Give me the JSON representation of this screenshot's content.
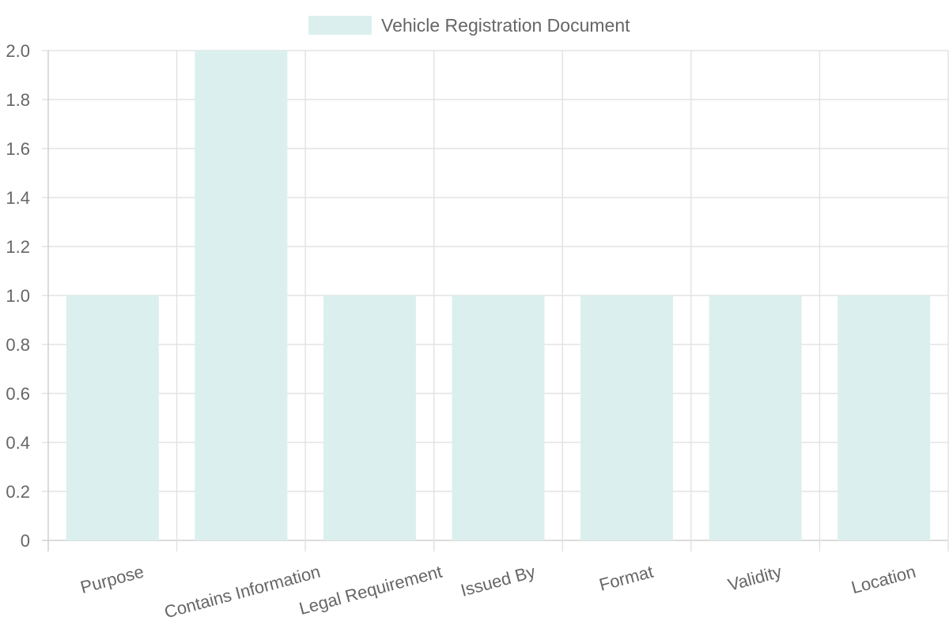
{
  "chart_data": {
    "type": "bar",
    "title": "",
    "xlabel": "",
    "ylabel": "",
    "categories": [
      "Purpose",
      "Contains Information",
      "Legal Requirement",
      "Issued By",
      "Format",
      "Validity",
      "Location"
    ],
    "series": [
      {
        "name": "Vehicle Registration Document",
        "values": [
          1,
          2,
          1,
          1,
          1,
          1,
          1
        ],
        "color": "#dbf0ee"
      }
    ],
    "ylim": [
      0,
      2
    ],
    "yticks": [
      "0",
      "0.2",
      "0.4",
      "0.6",
      "0.8",
      "1.0",
      "1.2",
      "1.4",
      "1.6",
      "1.8",
      "2.0"
    ],
    "grid": true,
    "legend_position": "top-center",
    "gridline_color": "#e3e3e3",
    "axis_color": "#d0d0d0",
    "text_color": "#666666"
  }
}
